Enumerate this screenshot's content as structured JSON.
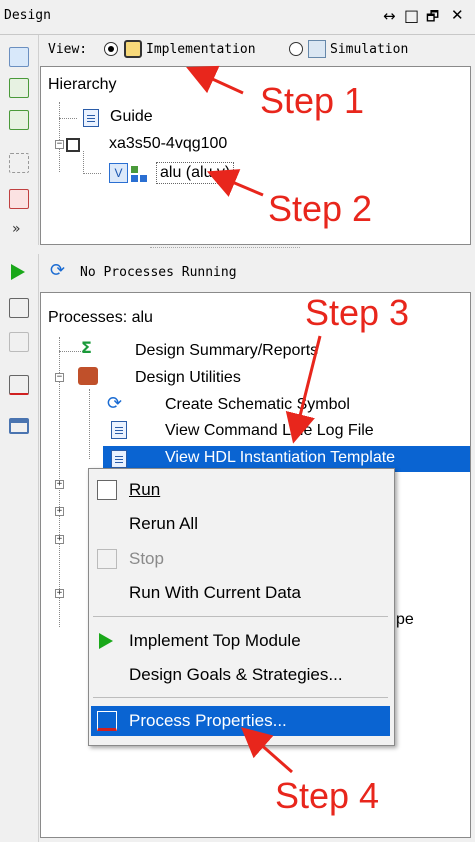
{
  "panel_title": "Design",
  "title_controls": {
    "move": "↔",
    "maximize": "□",
    "float": "🗗",
    "close": "✕"
  },
  "view": {
    "label": "View:",
    "options": [
      {
        "label": "Implementation",
        "selected": true
      },
      {
        "label": "Simulation",
        "selected": false
      }
    ]
  },
  "hierarchy": {
    "title": "Hierarchy",
    "items": [
      {
        "label": "Guide",
        "icon": "document-icon"
      },
      {
        "label": "xa3s50-4vqg100",
        "icon": "chip-icon"
      },
      {
        "label": "alu (alu.v)",
        "icon": "verilog-module-icon"
      }
    ]
  },
  "status": {
    "label": "No Processes Running"
  },
  "processes": {
    "title": "Processes: alu",
    "items": [
      {
        "label": "Design Summary/Reports",
        "icon": "sigma-icon"
      },
      {
        "label": "Design Utilities",
        "icon": "tools-icon"
      },
      {
        "label": "Create Schematic Symbol",
        "icon": "refresh-icon"
      },
      {
        "label": "View Command Line Log File",
        "icon": "document-icon"
      },
      {
        "label": "View HDL Instantiation Template",
        "icon": "document-icon",
        "selected": true
      }
    ],
    "partial_text": "pe"
  },
  "context_menu": {
    "items": [
      {
        "label": "Run",
        "mnemonic": "R",
        "enabled": true
      },
      {
        "label": "Rerun All",
        "mnemonic": "A",
        "enabled": true
      },
      {
        "label": "Stop",
        "mnemonic": "S",
        "enabled": false
      },
      {
        "label": "Run With Current Data",
        "mnemonic": "C",
        "enabled": true
      },
      {
        "label": "Implement Top Module",
        "mnemonic": "I",
        "enabled": true
      },
      {
        "label": "Design Goals & Strategies...",
        "mnemonic": "G",
        "enabled": true
      },
      {
        "label": "Process Properties...",
        "mnemonic": "P",
        "enabled": true,
        "highlighted": true
      }
    ]
  },
  "annotations": [
    "Step 1",
    "Step 2",
    "Step 3",
    "Step 4"
  ],
  "colors": {
    "selection": "#0a64d2",
    "annotation": "#e8261c",
    "run_green": "#1aa81a"
  }
}
